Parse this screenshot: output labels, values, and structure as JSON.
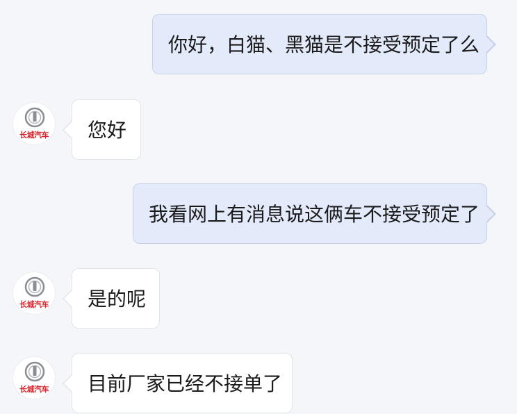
{
  "brand": {
    "name": "长城汽车",
    "color": "#d8242b"
  },
  "messages": [
    {
      "direction": "outgoing",
      "text": "你好，白猫、黑猫是不接受预定了么"
    },
    {
      "direction": "incoming",
      "text": "您好"
    },
    {
      "direction": "outgoing",
      "text": "我看网上有消息说这俩车不接受预定了"
    },
    {
      "direction": "incoming",
      "text": "是的呢"
    },
    {
      "direction": "incoming",
      "text": "目前厂家已经不接单了"
    }
  ],
  "colors": {
    "background": "#f5f6fa",
    "outgoing_bubble": "#e3eafa",
    "incoming_bubble": "#ffffff"
  }
}
